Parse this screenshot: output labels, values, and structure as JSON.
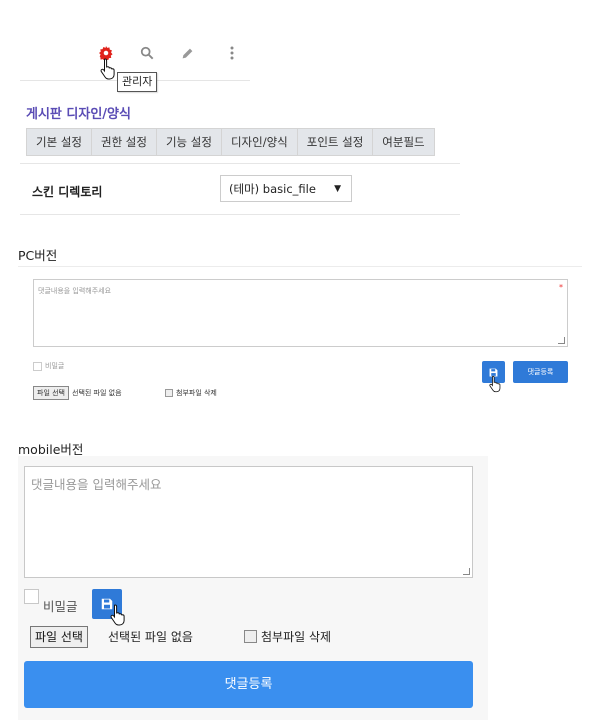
{
  "toolbar": {
    "icons": [
      "gear-icon",
      "search-icon",
      "pencil-icon",
      "more-vertical-icon"
    ],
    "tooltip": "관리자",
    "accent": "#e0221b"
  },
  "board": {
    "title": "게시판 디자인/양식",
    "tabs": [
      "기본 설정",
      "권한 설정",
      "기능 설정",
      "디자인/양식",
      "포인트 설정",
      "여분필드"
    ]
  },
  "skin": {
    "label": "스킨 디렉토리",
    "selected": "(테마) basic_file"
  },
  "pc": {
    "title": "PC버전",
    "placeholder": "댓글내용을 입력해주세요",
    "required_mark": "*",
    "secret_label": "비밀글",
    "file_button": "파일 선택",
    "file_status": "선택된 파일 없음",
    "delete_label": "첨부파일 삭제",
    "submit_label": "댓글등록"
  },
  "mobile": {
    "title": "mobile버전",
    "placeholder": "댓글내용을 입력해주세요",
    "secret_label": "비밀글",
    "file_button": "파일 선택",
    "file_status": "선택된 파일 없음",
    "delete_label": "첨부파일 삭제",
    "submit_label": "댓글등록"
  },
  "colors": {
    "primary_button": "#2f7ad8",
    "title_purple": "#5a4cb5"
  }
}
